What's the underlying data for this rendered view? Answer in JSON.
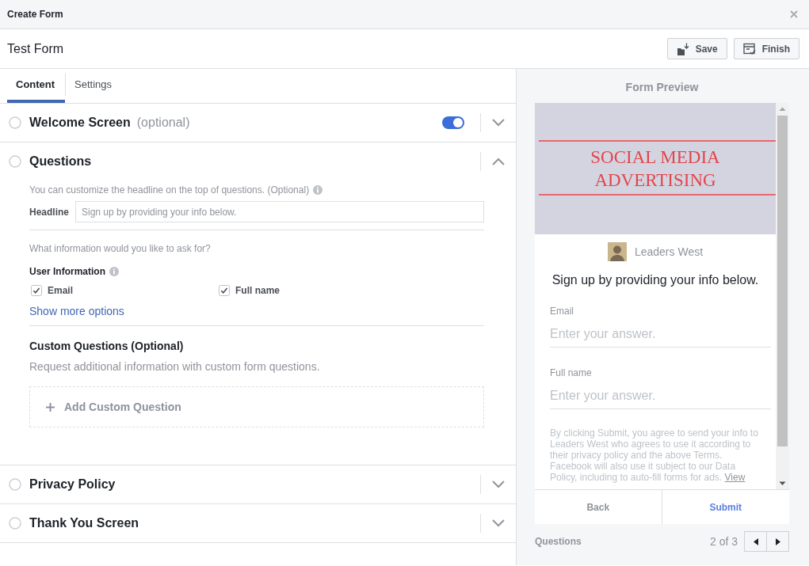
{
  "window": {
    "title": "Create Form"
  },
  "header": {
    "form_name": "Test Form",
    "buttons": [
      {
        "label": "Save",
        "kind": "save"
      },
      {
        "label": "Finish",
        "kind": "finish"
      }
    ]
  },
  "editor": {
    "tabs": [
      {
        "label": "Content",
        "selected": true
      },
      {
        "label": "Settings",
        "selected": false
      }
    ],
    "sections": [
      {
        "title": "Welcome Screen",
        "note": "(optional)",
        "expanded": false,
        "toggle": {
          "on": true
        }
      },
      {
        "title": "Questions",
        "expanded": true,
        "content": {
          "hint": "You can customize the headline on the top of questions. (Optional)",
          "headline": {
            "label": "Headline",
            "placeholder": "Sign up by providing your info below."
          },
          "prompt": "What information would you like to ask for?",
          "user_info_label": "User Information",
          "fields": [
            {
              "label": "Email",
              "checked": true
            },
            {
              "label": "Full name",
              "checked": true
            }
          ],
          "more_link": "Show more options",
          "custom_title": "Custom Questions (Optional)",
          "custom_description": "Request additional information with custom form questions.",
          "add_button": "Add Custom Question"
        }
      },
      {
        "title": "Privacy Policy",
        "expanded": false
      },
      {
        "title": "Thank You Screen",
        "expanded": false
      }
    ]
  },
  "preview": {
    "title": "Form Preview",
    "cover": {
      "headline": "SOCIAL MEDIA ADVERTISING"
    },
    "page_name": "Leaders West",
    "headline": "Sign up by providing your info below.",
    "questions": [
      {
        "label": "Email",
        "placeholder": "Enter your answer."
      },
      {
        "label": "Full name",
        "placeholder": "Enter your answer."
      }
    ],
    "disclaimer": {
      "text": "By clicking Submit, you agree to send your info to Leaders West who agrees to use it according to their privacy policy and the above Terms. Facebook will also use it subject to our Data Policy, including to auto-fill forms for ads.",
      "link": "View"
    },
    "buttons": [
      {
        "label": "Back",
        "kind": "back"
      },
      {
        "label": "Submit",
        "kind": "submit"
      }
    ],
    "step_name": "Questions",
    "pager": "2 of 3"
  }
}
